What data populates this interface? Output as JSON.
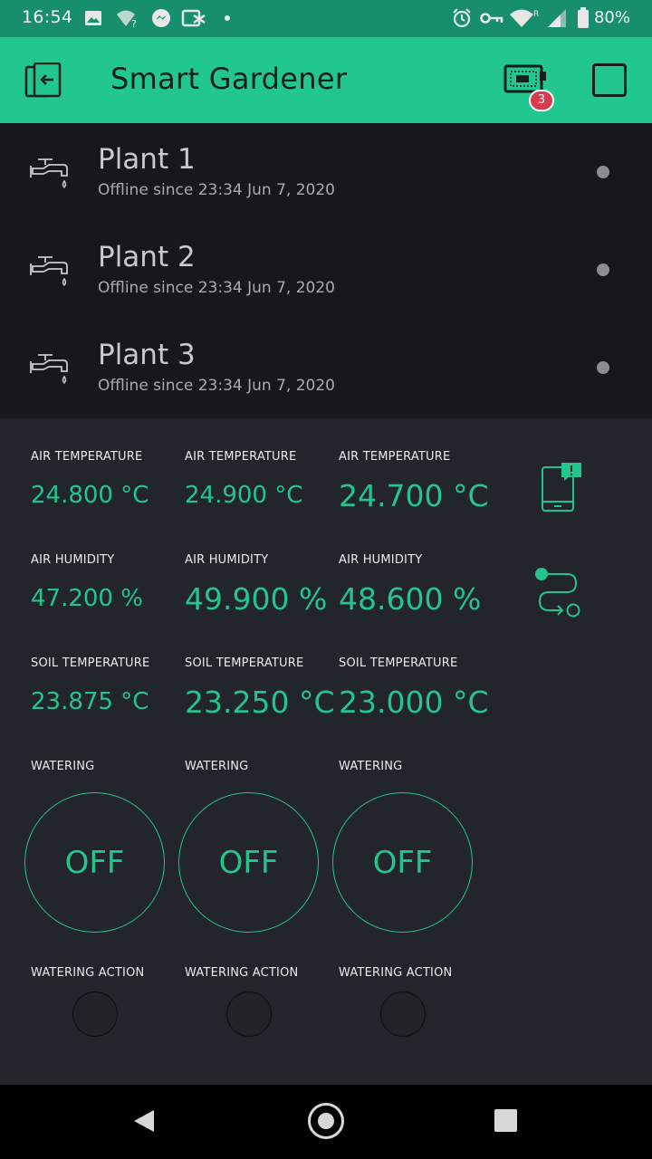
{
  "status_bar": {
    "time": "16:54",
    "battery": "80%",
    "icons": [
      "image-icon",
      "wifi-question-icon",
      "messenger-icon",
      "camera-icon",
      "dot-icon",
      "alarm-icon",
      "vpn-key-icon",
      "wifi-icon",
      "signal-icon",
      "battery-icon"
    ]
  },
  "app_bar": {
    "title": "Smart Gardener",
    "devices_badge": "3"
  },
  "devices": [
    {
      "name": "Plant 1",
      "status": "Offline since 23:34 Jun 7, 2020"
    },
    {
      "name": "Plant 2",
      "status": "Offline since 23:34 Jun 7, 2020"
    },
    {
      "name": "Plant 3",
      "status": "Offline since 23:34 Jun 7, 2020"
    }
  ],
  "widgets": {
    "air_temperature": {
      "label": "AIR TEMPERATURE",
      "values": [
        "24.800 °C",
        "24.900 °C",
        "24.700 °C"
      ]
    },
    "air_humidity": {
      "label": "AIR HUMIDITY",
      "values": [
        "47.200 %",
        "49.900 %",
        "48.600 %"
      ]
    },
    "soil_temperature": {
      "label": "SOIL TEMPERATURE",
      "values": [
        "23.875 °C",
        "23.250 °C",
        "23.000 °C"
      ]
    },
    "watering": {
      "label": "WATERING",
      "states": [
        "OFF",
        "OFF",
        "OFF"
      ]
    },
    "watering_action": {
      "label": "WATERING ACTION"
    }
  },
  "colors": {
    "accent": "#23c48e",
    "app_bar": "#22c68f",
    "status_bar": "#178f6c",
    "list_bg": "#17181d",
    "dashboard_bg": "#22252b",
    "badge": "#d93a4d"
  }
}
